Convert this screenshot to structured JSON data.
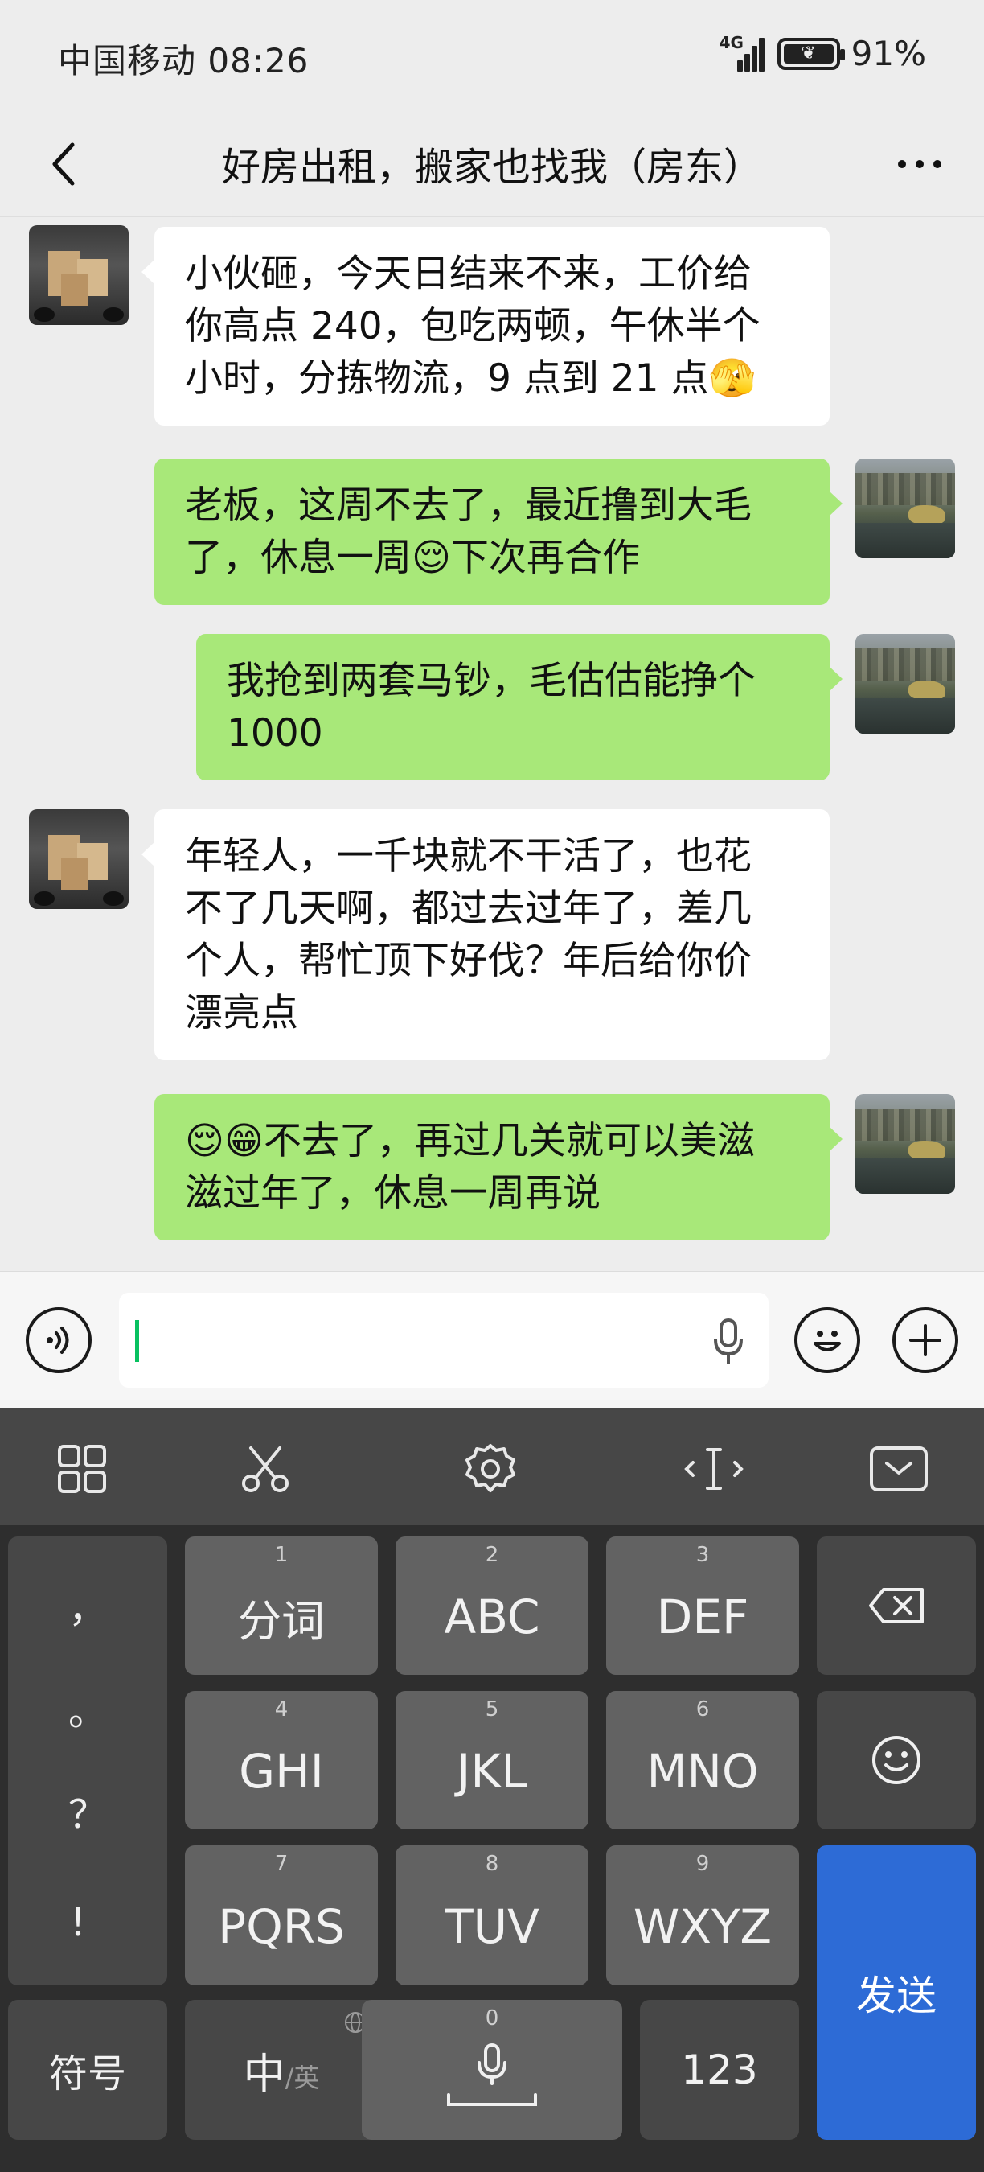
{
  "status_bar": {
    "carrier_time": "中国移动 08:26",
    "network": "4G",
    "battery": "91%"
  },
  "header": {
    "title": "好房出租，搬家也找我（房东）"
  },
  "messages": [
    {
      "side": "in",
      "text": "小伙砸，今天日结来不来，工价给\n你高点 240，包吃两顿，午休半个\n小时，分拣物流，9 点到 21 点🫣"
    },
    {
      "side": "out",
      "text": "老板，这周不去了，最近撸到大毛\n了，休息一周😌下次再合作"
    },
    {
      "side": "out",
      "text": "我抢到两套马钞，毛估估能挣个\n1000"
    },
    {
      "side": "in",
      "text": "年轻人，一千块就不干活了，也花\n不了几天啊，都过去过年了，差几\n个人，帮忙顶下好伐？年后给你价\n漂亮点"
    },
    {
      "side": "out",
      "text": "😌😁不去了，再过几关就可以美滋\n滋过年了，休息一周再说"
    }
  ],
  "input": {
    "value": "",
    "placeholder": ""
  },
  "keyboard": {
    "punctuation": [
      "，",
      "。",
      "？",
      "！"
    ],
    "keys": [
      {
        "num": "1",
        "label": "分词"
      },
      {
        "num": "2",
        "label": "ABC"
      },
      {
        "num": "3",
        "label": "DEF"
      },
      {
        "num": "4",
        "label": "GHI"
      },
      {
        "num": "5",
        "label": "JKL"
      },
      {
        "num": "6",
        "label": "MNO"
      },
      {
        "num": "7",
        "label": "PQRS"
      },
      {
        "num": "8",
        "label": "TUV"
      },
      {
        "num": "9",
        "label": "WXYZ"
      }
    ],
    "symbols_label": "符号",
    "lang_label": "中",
    "lang_alt_label": "/英",
    "space_num": "0",
    "numeric_label": "123",
    "send_label": "发送"
  },
  "colors": {
    "outgoing_bubble": "#a8e879",
    "incoming_bubble": "#ffffff",
    "send_key": "#2d6bd6",
    "caret": "#07c160"
  }
}
